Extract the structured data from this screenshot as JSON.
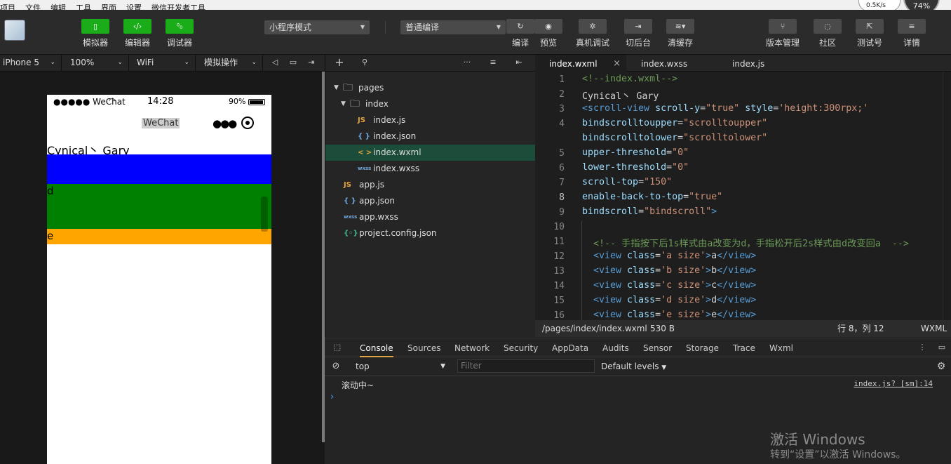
{
  "menubar": {
    "items": [
      "项目",
      "文件",
      "编辑",
      "工具",
      "界面",
      "设置",
      "微信开发者工具"
    ],
    "net_speed": "0.5K/s",
    "cpu": "74%"
  },
  "toolbar": {
    "left_buttons": [
      {
        "label": "模拟器",
        "icon": "phone-icon",
        "glyph": "▯"
      },
      {
        "label": "编辑器",
        "icon": "code-icon",
        "glyph": "‹/›"
      },
      {
        "label": "调试器",
        "icon": "debug-icon",
        "glyph": "⁰₀"
      }
    ],
    "mode_select": "小程序模式",
    "compile_select": "普通编译",
    "mid_buttons": [
      {
        "label": "编译",
        "icon": "refresh-icon",
        "glyph": "↻"
      },
      {
        "label": "预览",
        "icon": "eye-icon",
        "glyph": "◉"
      },
      {
        "label": "真机调试",
        "icon": "bug-icon",
        "glyph": "✲"
      },
      {
        "label": "切后台",
        "icon": "switch-icon",
        "glyph": "⇥"
      },
      {
        "label": "清缓存",
        "icon": "layers-icon",
        "glyph": "≋▾"
      }
    ],
    "right_buttons": [
      {
        "label": "版本管理",
        "icon": "branch-icon",
        "glyph": "⑂"
      },
      {
        "label": "社区",
        "icon": "chat-icon",
        "glyph": "◌"
      },
      {
        "label": "测试号",
        "icon": "external-icon",
        "glyph": "⇱"
      },
      {
        "label": "详情",
        "icon": "menu-icon",
        "glyph": "≡"
      }
    ]
  },
  "devicebar": {
    "device": "iPhone 5",
    "zoom": "100%",
    "network": "WiFi",
    "operation": "模拟操作"
  },
  "phone": {
    "carrier": "●●●●● WeChat",
    "time": "14:28",
    "battery": "90%",
    "nav_title": "WeChat",
    "page_text": "Cynical丶 Gary",
    "block_d": "d",
    "block_e": "e"
  },
  "explorer": {
    "rows": [
      {
        "name": "pages",
        "type": "folder",
        "level": 0
      },
      {
        "name": "index",
        "type": "folder",
        "level": 1
      },
      {
        "name": "index.js",
        "type": "js",
        "level": 2
      },
      {
        "name": "index.json",
        "type": "json",
        "level": 2
      },
      {
        "name": "index.wxml",
        "type": "wxml",
        "level": 2,
        "selected": true
      },
      {
        "name": "index.wxss",
        "type": "wxss",
        "level": 2
      },
      {
        "name": "app.js",
        "type": "js",
        "level": 0
      },
      {
        "name": "app.json",
        "type": "json",
        "level": 0
      },
      {
        "name": "app.wxss",
        "type": "wxss",
        "level": 0
      },
      {
        "name": "project.config.json",
        "type": "config",
        "level": 0
      }
    ]
  },
  "editor": {
    "tabs": [
      {
        "label": "index.wxml",
        "active": true
      },
      {
        "label": "index.wxss",
        "active": false
      },
      {
        "label": "index.js",
        "active": false
      }
    ],
    "lines": [
      {
        "n": "1",
        "tokens": [
          [
            "c-com",
            "<!--index.wxml-->"
          ]
        ]
      },
      {
        "n": "2",
        "tokens": [
          [
            "c-txt",
            "Cynical丶 Gary"
          ]
        ]
      },
      {
        "n": "3",
        "tokens": [
          [
            "c-tag",
            "<scroll-view "
          ],
          [
            "c-attr",
            "scroll-y"
          ],
          [
            "c-txt",
            "="
          ],
          [
            "c-str",
            "\"true\" "
          ],
          [
            "c-attr",
            "style"
          ],
          [
            "c-txt",
            "="
          ],
          [
            "c-str",
            "'height:300rpx;'"
          ]
        ]
      },
      {
        "n": "4",
        "tokens": [
          [
            "c-attr",
            "bindscrolltoupper"
          ],
          [
            "c-txt",
            "="
          ],
          [
            "c-str",
            "\"scrolltoupper\""
          ]
        ]
      },
      {
        "n": "",
        "tokens": [
          [
            "c-attr",
            "bindscrolltolower"
          ],
          [
            "c-txt",
            "="
          ],
          [
            "c-str",
            "\"scrolltolower\""
          ]
        ]
      },
      {
        "n": "5",
        "tokens": [
          [
            "c-attr",
            "upper-threshold"
          ],
          [
            "c-txt",
            "="
          ],
          [
            "c-str",
            "\"0\""
          ]
        ]
      },
      {
        "n": "6",
        "tokens": [
          [
            "c-attr",
            "lower-threshold"
          ],
          [
            "c-txt",
            "="
          ],
          [
            "c-str",
            "\"0\""
          ]
        ]
      },
      {
        "n": "7",
        "tokens": [
          [
            "c-attr",
            "scroll-top"
          ],
          [
            "c-txt",
            "="
          ],
          [
            "c-str",
            "\"150\""
          ]
        ]
      },
      {
        "n": "8",
        "tokens": [
          [
            "c-attr",
            "enable-back-to-top"
          ],
          [
            "c-txt",
            "="
          ],
          [
            "c-str",
            "\"true\""
          ]
        ]
      },
      {
        "n": "9",
        "tokens": [
          [
            "c-attr",
            "bindscroll"
          ],
          [
            "c-txt",
            "="
          ],
          [
            "c-str",
            "\"bindscroll\""
          ],
          [
            "c-tag",
            ">"
          ]
        ]
      },
      {
        "n": "10",
        "tokens": []
      },
      {
        "n": "11",
        "tokens": [
          [
            "c-com",
            "  <!-- 手指按下后1s样式由a改变为d，手指松开后2s样式由d改变回a  -->"
          ]
        ]
      },
      {
        "n": "12",
        "tokens": [
          [
            "c-tag",
            "  <view "
          ],
          [
            "c-attr",
            "class"
          ],
          [
            "c-txt",
            "="
          ],
          [
            "c-str",
            "'a size'"
          ],
          [
            "c-tag",
            ">"
          ],
          [
            "c-txt",
            "a"
          ],
          [
            "c-tag",
            "</view>"
          ]
        ]
      },
      {
        "n": "13",
        "tokens": [
          [
            "c-tag",
            "  <view "
          ],
          [
            "c-attr",
            "class"
          ],
          [
            "c-txt",
            "="
          ],
          [
            "c-str",
            "'b size'"
          ],
          [
            "c-tag",
            ">"
          ],
          [
            "c-txt",
            "b"
          ],
          [
            "c-tag",
            "</view>"
          ]
        ]
      },
      {
        "n": "14",
        "tokens": [
          [
            "c-tag",
            "  <view "
          ],
          [
            "c-attr",
            "class"
          ],
          [
            "c-txt",
            "="
          ],
          [
            "c-str",
            "'c size'"
          ],
          [
            "c-tag",
            ">"
          ],
          [
            "c-txt",
            "c"
          ],
          [
            "c-tag",
            "</view>"
          ]
        ]
      },
      {
        "n": "15",
        "tokens": [
          [
            "c-tag",
            "  <view "
          ],
          [
            "c-attr",
            "class"
          ],
          [
            "c-txt",
            "="
          ],
          [
            "c-str",
            "'d size'"
          ],
          [
            "c-tag",
            ">"
          ],
          [
            "c-txt",
            "d"
          ],
          [
            "c-tag",
            "</view>"
          ]
        ]
      },
      {
        "n": "16",
        "tokens": [
          [
            "c-tag",
            "  <view "
          ],
          [
            "c-attr",
            "class"
          ],
          [
            "c-txt",
            "="
          ],
          [
            "c-str",
            "'e size'"
          ],
          [
            "c-tag",
            ">"
          ],
          [
            "c-txt",
            "e"
          ],
          [
            "c-tag",
            "</view>"
          ]
        ]
      }
    ],
    "current_line": "8",
    "status": {
      "path": "/pages/index/index.wxml",
      "size": "530 B",
      "position": "行 8，列 12",
      "lang": "WXML"
    }
  },
  "console": {
    "tabs": [
      "Console",
      "Sources",
      "Network",
      "Security",
      "AppData",
      "Audits",
      "Sensor",
      "Storage",
      "Trace",
      "Wxml"
    ],
    "active_tab": "Console",
    "context": "top",
    "filter_placeholder": "Filter",
    "levels": "Default levels",
    "message": "滚动中~",
    "message_source": "index.js? [sm]:14",
    "prompt": "›"
  },
  "watermark": {
    "line1": "激活 Windows",
    "line2": "转到“设置”以激活 Windows。"
  }
}
